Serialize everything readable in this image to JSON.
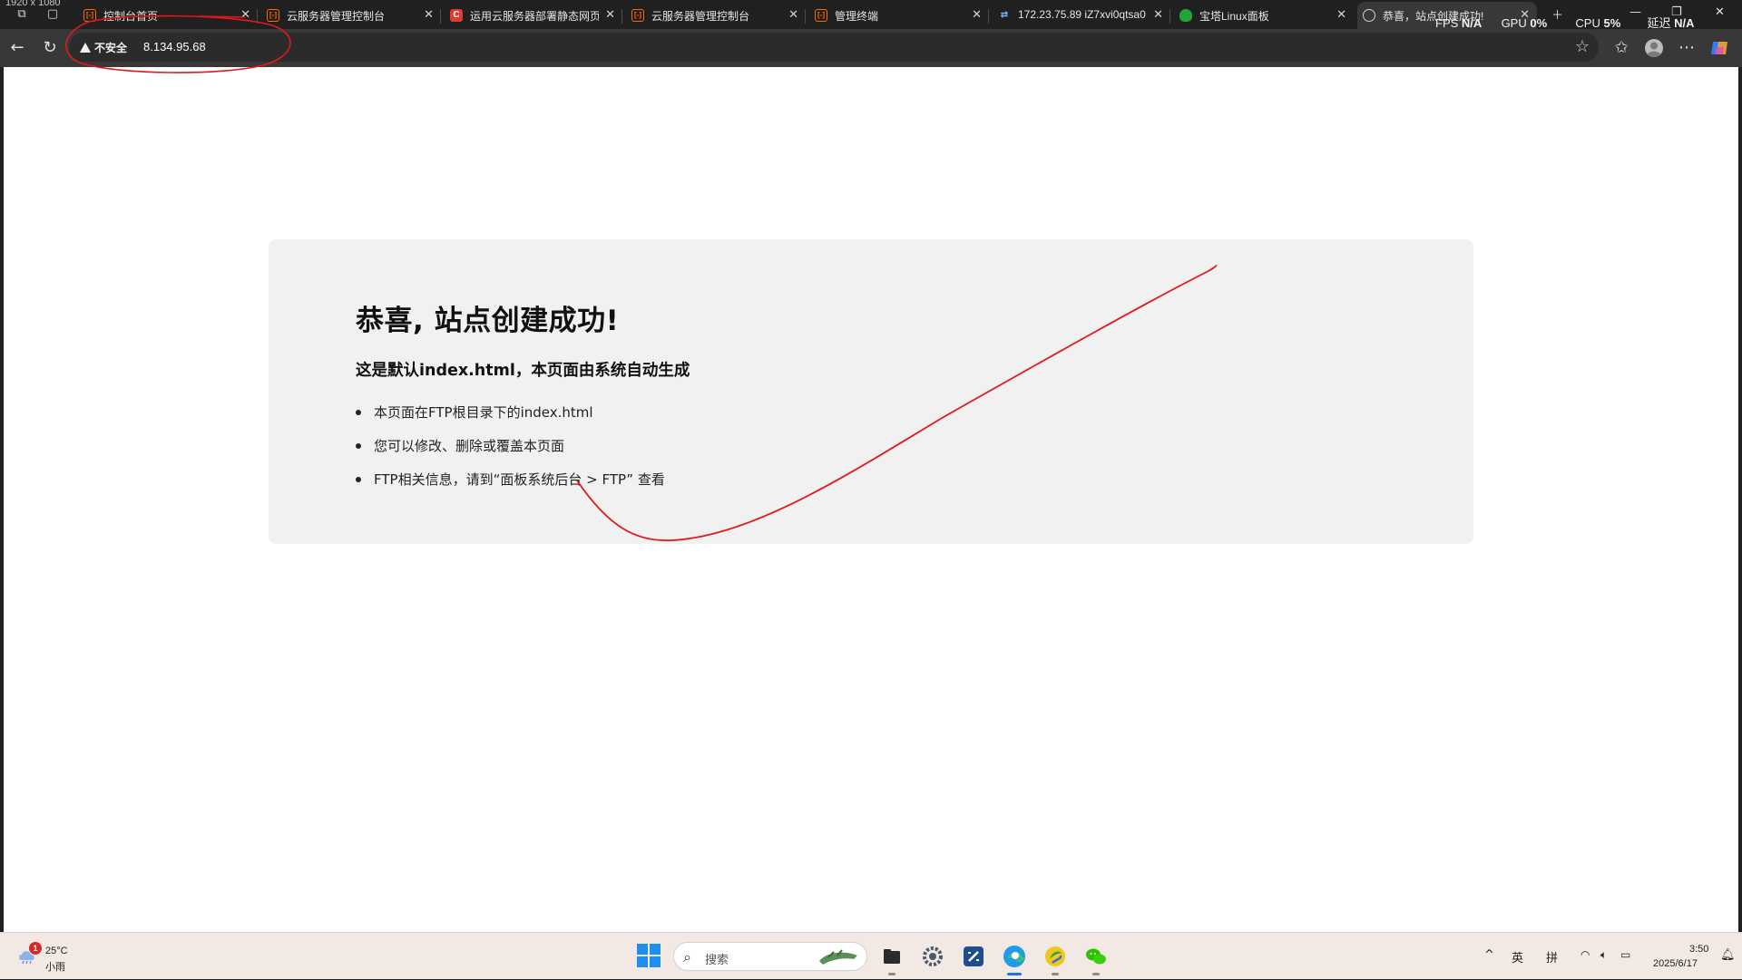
{
  "screen_overlay": {
    "resolution": "1920 x 1080"
  },
  "tabs": [
    {
      "title": "控制台首页",
      "favicon": "aliyun-icon",
      "active": false
    },
    {
      "title": "云服务器管理控制台",
      "favicon": "aliyun-icon",
      "active": false
    },
    {
      "title": "运用云服务器部署静态网页",
      "favicon": "csdn-icon",
      "active": false
    },
    {
      "title": "云服务器管理控制台",
      "favicon": "aliyun-icon",
      "active": false
    },
    {
      "title": "管理终端",
      "favicon": "aliyun-icon",
      "active": false
    },
    {
      "title": "172.23.75.89 iZ7xvi0qtsa0",
      "favicon": "ssh-icon",
      "active": false
    },
    {
      "title": "宝塔Linux面板",
      "favicon": "bt-icon",
      "active": false
    },
    {
      "title": "恭喜，站点创建成功!",
      "favicon": "globe-icon",
      "active": true
    }
  ],
  "perf_overlay": {
    "fps_label": "FPS",
    "fps_value": "N/A",
    "gpu_label": "GPU",
    "gpu_value": "0%",
    "cpu_label": "CPU",
    "cpu_value": "5%",
    "latency_label": "延迟",
    "latency_value": "N/A"
  },
  "address_bar": {
    "security_label": "不安全",
    "url": "8.134.95.68"
  },
  "page": {
    "title": "恭喜, 站点创建成功!",
    "subtitle": "这是默认index.html，本页面由系统自动生成",
    "items": [
      "本页面在FTP根目录下的index.html",
      "您可以修改、删除或覆盖本页面",
      "FTP相关信息，请到“面板系统后台 > FTP” 查看"
    ]
  },
  "colors": {
    "annotation": "#e0191d",
    "taskbar": "#f2e8e4",
    "card": "#f1f1f1"
  },
  "taskbar": {
    "weather_badge": "1",
    "weather_temp": "25°C",
    "weather_desc": "小雨",
    "search_placeholder": "搜索",
    "apps": [
      "file-explorer-icon",
      "settings-icon",
      "code-editor-icon",
      "edge-icon",
      "qq-browser-icon",
      "wechat-icon"
    ],
    "tray_chevron": "^",
    "ime_lang": "英",
    "ime_mode": "拼",
    "time": "3:50",
    "date": "2025/6/17"
  }
}
